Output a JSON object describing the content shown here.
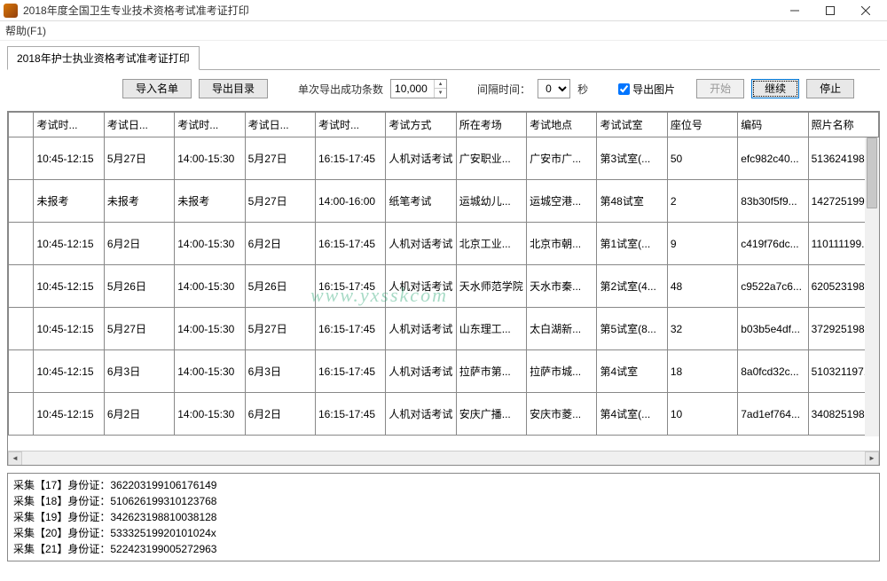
{
  "window": {
    "title": "2018年度全国卫生专业技术资格考试准考证打印"
  },
  "menu": {
    "help": "帮助(F1)"
  },
  "tab": {
    "label": "2018年护士执业资格考试准考证打印"
  },
  "toolbar": {
    "import_btn": "导入名单",
    "export_btn": "导出目录",
    "batch_label": "单次导出成功条数",
    "batch_value": "10,000",
    "interval_label": "间隔时间：",
    "interval_value": "0",
    "interval_unit": "秒",
    "export_image": "导出图片",
    "start_btn": "开始",
    "continue_btn": "继续",
    "stop_btn": "停止"
  },
  "table": {
    "headers": [
      "",
      "考试时...",
      "考试日...",
      "考试时...",
      "考试日...",
      "考试时...",
      "考试方式",
      "所在考场",
      "考试地点",
      "考试试室",
      "座位号",
      "编码",
      "照片名称"
    ],
    "rows": [
      [
        "10:45-12:15",
        "5月27日",
        "14:00-15:30",
        "5月27日",
        "16:15-17:45",
        "人机对话考试",
        "广安职业...",
        "广安市广...",
        "第3试室(...",
        "50",
        "efc982c40...",
        "513624198..."
      ],
      [
        "未报考",
        "未报考",
        "未报考",
        "5月27日",
        "14:00-16:00",
        "纸笔考试",
        "运城幼儿...",
        "运城空港...",
        "第48试室",
        "2",
        "83b30f5f9...",
        "142725199..."
      ],
      [
        "10:45-12:15",
        "6月2日",
        "14:00-15:30",
        "6月2日",
        "16:15-17:45",
        "人机对话考试",
        "北京工业...",
        "北京市朝...",
        "第1试室(...",
        "9",
        "c419f76dc...",
        "110111199..."
      ],
      [
        "10:45-12:15",
        "5月26日",
        "14:00-15:30",
        "5月26日",
        "16:15-17:45",
        "人机对话考试",
        "天水师范学院",
        "天水市秦...",
        "第2试室(4...",
        "48",
        "c9522a7c6...",
        "620523198..."
      ],
      [
        "10:45-12:15",
        "5月27日",
        "14:00-15:30",
        "5月27日",
        "16:15-17:45",
        "人机对话考试",
        "山东理工...",
        "太白湖新...",
        "第5试室(8...",
        "32",
        "b03b5e4df...",
        "372925198..."
      ],
      [
        "10:45-12:15",
        "6月3日",
        "14:00-15:30",
        "6月3日",
        "16:15-17:45",
        "人机对话考试",
        "拉萨市第...",
        "拉萨市城...",
        "第4试室",
        "18",
        "8a0fcd32c...",
        "510321197..."
      ],
      [
        "10:45-12:15",
        "6月2日",
        "14:00-15:30",
        "6月2日",
        "16:15-17:45",
        "人机对话考试",
        "安庆广播...",
        "安庆市菱...",
        "第4试室(...",
        "10",
        "7ad1ef764...",
        "340825198..."
      ]
    ]
  },
  "log": [
    "采集【17】身份证：362203199106176149",
    "采集【18】身份证：510626199310123768",
    "采集【19】身份证：342623198810038128",
    "采集【20】身份证：53332519920101024x",
    "采集【21】身份证：522423199005272963"
  ],
  "watermark": "www.yxsskcom"
}
